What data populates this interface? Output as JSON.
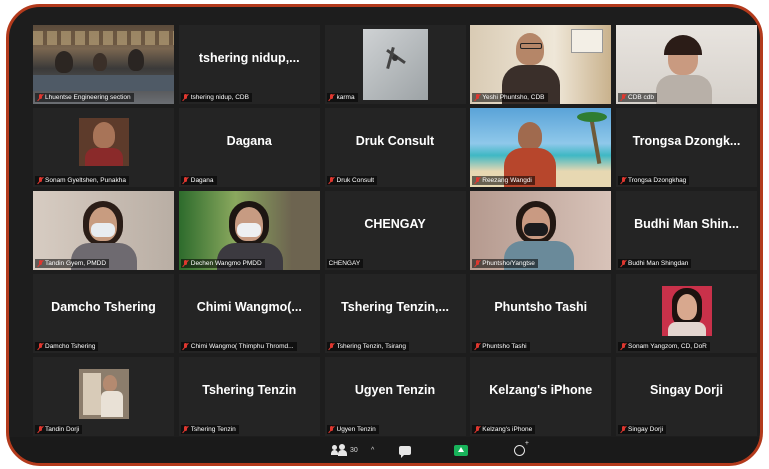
{
  "participants": [
    {
      "label": "Lhuentse Engineering section",
      "display": "",
      "video": "room"
    },
    {
      "label": "tshering nidup, CDB",
      "display": "tshering  nidup,...",
      "video": ""
    },
    {
      "label": "karma",
      "display": "",
      "video": "fan"
    },
    {
      "label": "Yeshi Phuntsho, CDB",
      "display": "",
      "video": "man-glasses",
      "active": true
    },
    {
      "label": "CDB cdb",
      "display": "",
      "video": "woman-glasses"
    },
    {
      "label": "Sonam Gyeltshen, Punakha",
      "display": "",
      "video": "thumb-man"
    },
    {
      "label": "Dagana",
      "display": "Dagana",
      "video": ""
    },
    {
      "label": "Druk Consult",
      "display": "Druk Consult",
      "video": ""
    },
    {
      "label": "Reezang Wangdi",
      "display": "",
      "video": "beach"
    },
    {
      "label": "Trongsa Dzongkhag",
      "display": "Trongsa Dzongk...",
      "video": ""
    },
    {
      "label": "Tandin Gyem, PMDD",
      "display": "",
      "video": "woman-mask"
    },
    {
      "label": "Dechen Wangmo PMDD",
      "display": "",
      "video": "woman-mask-green"
    },
    {
      "label": "CHENGAY",
      "display": "CHENGAY",
      "video": "",
      "nomic": true
    },
    {
      "label": "Phuntsho/Yangtse",
      "display": "",
      "video": "woman-mask-pink"
    },
    {
      "label": "Budhi Man Shingdan",
      "display": "Budhi Man Shin...",
      "video": ""
    },
    {
      "label": "Damcho Tshering",
      "display": "Damcho Tshering",
      "video": ""
    },
    {
      "label": "Chimi Wangmo( Thimphu Thromd...",
      "display": "Chimi  Wangmo(...",
      "video": ""
    },
    {
      "label": "Tshering Tenzin, Tsirang",
      "display": "Tshering  Tenzin,...",
      "video": ""
    },
    {
      "label": "Phuntsho Tashi",
      "display": "Phuntsho Tashi",
      "video": ""
    },
    {
      "label": "Sonam Yangzom, CD, DoR",
      "display": "",
      "video": "thumb-woman"
    },
    {
      "label": "Tandin Dorji",
      "display": "",
      "video": "thumb-photo"
    },
    {
      "label": "Tshering Tenzin",
      "display": "Tshering Tenzin",
      "video": ""
    },
    {
      "label": "Ugyen Tenzin",
      "display": "Ugyen Tenzin",
      "video": ""
    },
    {
      "label": "Kelzang's iPhone",
      "display": "Kelzang's iPhone",
      "video": ""
    },
    {
      "label": "Singay Dorji",
      "display": "Singay Dorji",
      "video": ""
    }
  ],
  "toolbar": {
    "participant_count": "30",
    "caret": "^",
    "icons": [
      "participants-icon",
      "chat-icon",
      "share-screen-icon",
      "reactions-icon"
    ],
    "share_color": "#18b35a"
  },
  "colors": {
    "frame_border": "#b33a1c",
    "active_speaker": "#b6d649",
    "muted_mic": "#e0372f"
  }
}
